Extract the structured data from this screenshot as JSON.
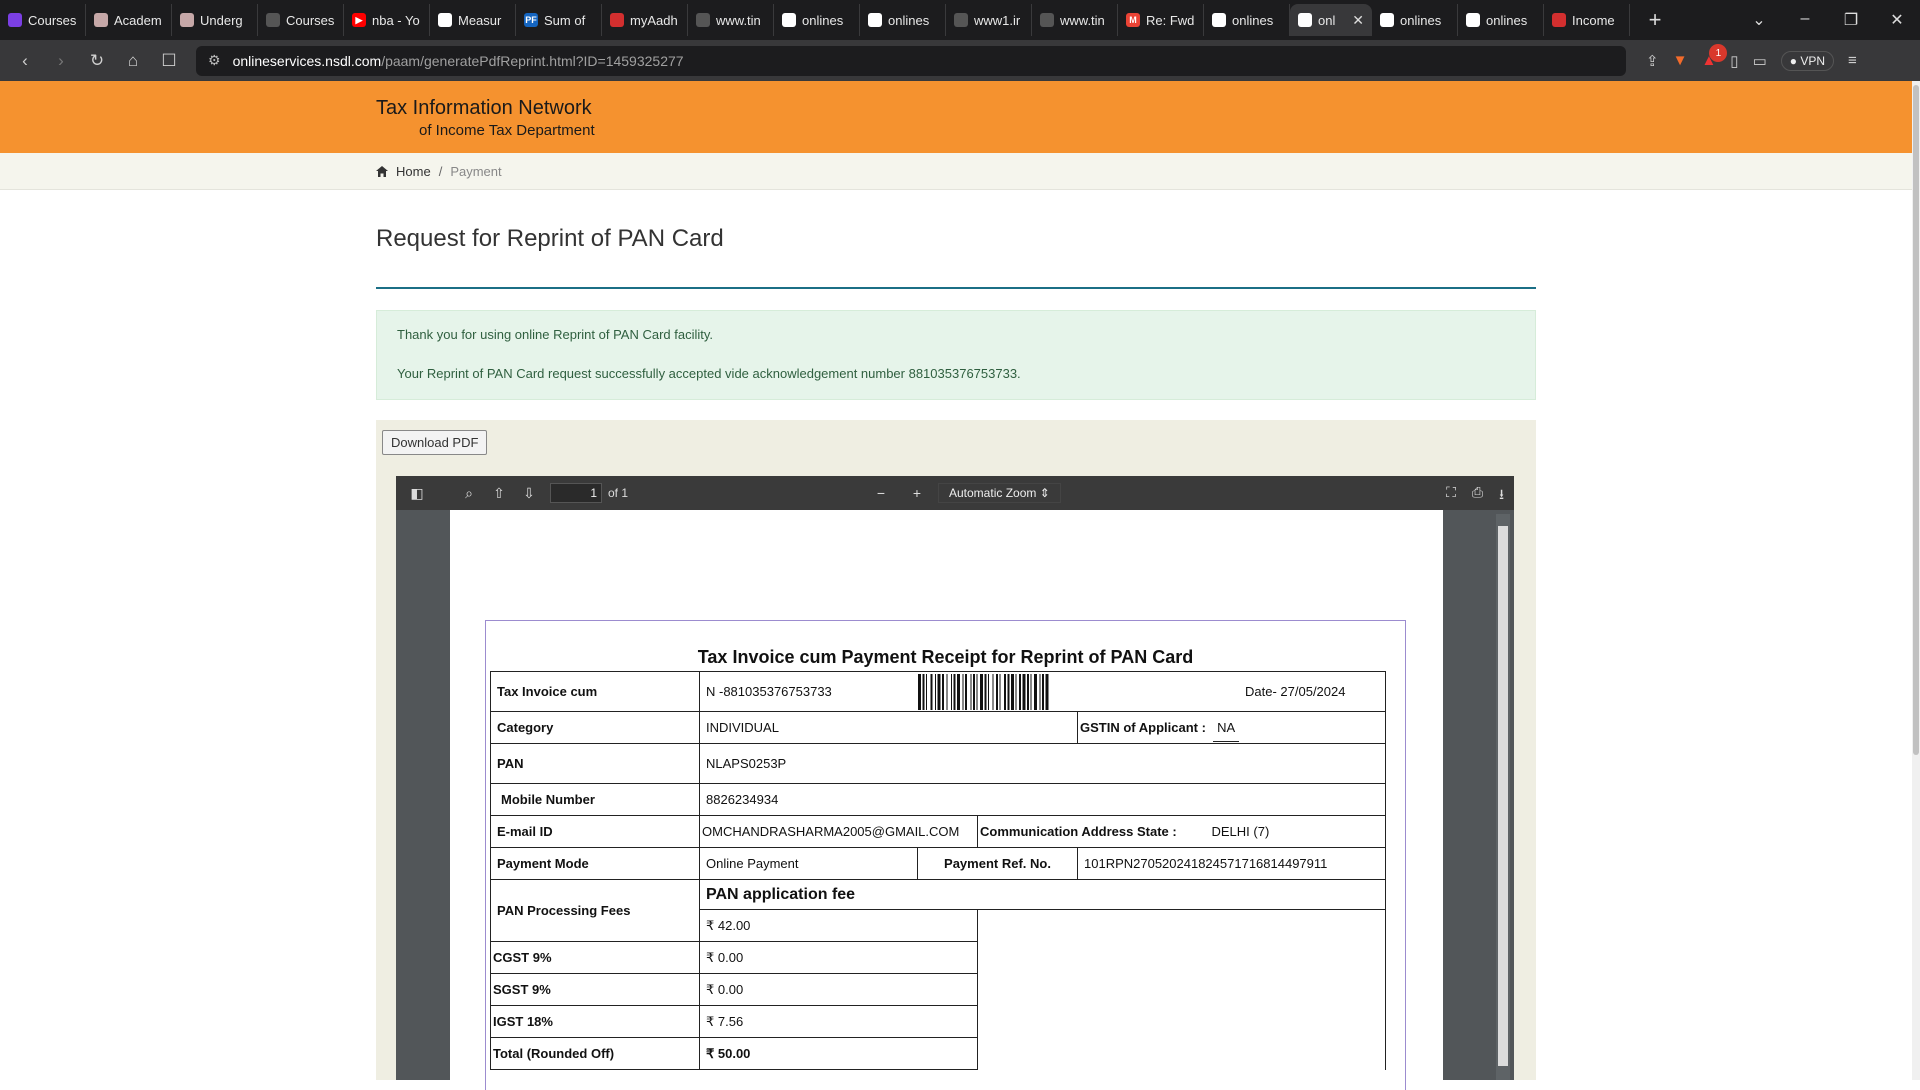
{
  "browser": {
    "tabs": [
      {
        "label": "Courses",
        "fav_color": "#7b3fe4",
        "fav_text": ""
      },
      {
        "label": "Academ",
        "fav_color": "#c6a8a8",
        "fav_text": ""
      },
      {
        "label": "Underg",
        "fav_color": "#c6a8a8",
        "fav_text": ""
      },
      {
        "label": "Courses",
        "fav_color": "#555555",
        "fav_text": ""
      },
      {
        "label": "nba - Yo",
        "fav_color": "#ff0000",
        "fav_text": "▶"
      },
      {
        "label": "Measur",
        "fav_color": "#ffffff",
        "fav_text": ""
      },
      {
        "label": "Sum of",
        "fav_color": "#1565c0",
        "fav_text": "PF"
      },
      {
        "label": "myAadh",
        "fav_color": "#d32f2f",
        "fav_text": ""
      },
      {
        "label": "www.tin",
        "fav_color": "#555555",
        "fav_text": ""
      },
      {
        "label": "onlines",
        "fav_color": "#ffffff",
        "fav_text": ""
      },
      {
        "label": "onlines",
        "fav_color": "#ffffff",
        "fav_text": ""
      },
      {
        "label": "www1.ir",
        "fav_color": "#555555",
        "fav_text": ""
      },
      {
        "label": "www.tin",
        "fav_color": "#555555",
        "fav_text": ""
      },
      {
        "label": "Re: Fwd",
        "fav_color": "#ea4335",
        "fav_text": "M"
      },
      {
        "label": "onlines",
        "fav_color": "#ffffff",
        "fav_text": ""
      },
      {
        "label": "onl",
        "fav_color": "#ffffff",
        "fav_text": "",
        "active": true
      },
      {
        "label": "onlines",
        "fav_color": "#ffffff",
        "fav_text": ""
      },
      {
        "label": "onlines",
        "fav_color": "#ffffff",
        "fav_text": ""
      },
      {
        "label": "Income",
        "fav_color": "#d32f2f",
        "fav_text": ""
      }
    ],
    "url_host": "onlineservices.nsdl.com",
    "url_path": "/paam/generatePdfReprint.html?ID=1459325277",
    "notification_count": "1",
    "vpn_label": "VPN"
  },
  "site": {
    "brand_line1": "Tax Information Network",
    "brand_line2": "of Income Tax Department",
    "breadcrumb_home": "Home",
    "breadcrumb_sep": "/",
    "breadcrumb_current": "Payment",
    "page_title": "Request for Reprint of PAN Card",
    "success_line1": "Thank you for using online Reprint of PAN Card facility.",
    "success_line2": "Your Reprint of PAN Card request successfully accepted vide acknowledgement number 881035376753733.",
    "download_label": "Download PDF"
  },
  "viewer": {
    "page_number": "1",
    "page_of": "of 1",
    "zoom_label": "Automatic Zoom"
  },
  "receipt": {
    "title": "Tax Invoice cum Payment Receipt  for Reprint of PAN Card",
    "tax_invoice_label": "Tax Invoice cum",
    "ack_value": "N -881035376753733",
    "date_value": "Date- 27/05/2024",
    "category_label": "Category",
    "category_value": "INDIVIDUAL",
    "gstin_label": "GSTIN of Applicant :",
    "gstin_value": "NA",
    "pan_label": "PAN",
    "pan_value": "NLAPS0253P",
    "mobile_label": "Mobile Number",
    "mobile_value": "8826234934",
    "email_label": "E-mail ID",
    "email_value": "OMCHANDRASHARMA2005@GMAIL.COM",
    "comm_state_label": "Communication Address State :",
    "comm_state_value": "DELHI (7)",
    "payment_mode_label": "Payment Mode",
    "payment_mode_value": "Online Payment",
    "payment_ref_label": "Payment Ref. No.",
    "payment_ref_value": "101RPN270520241824571716814497911",
    "fees_label": "PAN Processing Fees",
    "fee_heading": "PAN application fee",
    "fee_value": "₹ 42.00",
    "cgst_label": "CGST 9%",
    "cgst_value": "₹ 0.00",
    "sgst_label": "SGST 9%",
    "sgst_value": "₹ 0.00",
    "igst_label": "IGST 18%",
    "igst_value": "₹ 7.56",
    "total_label": "Total (Rounded Off)",
    "total_value": "₹ 50.00"
  }
}
